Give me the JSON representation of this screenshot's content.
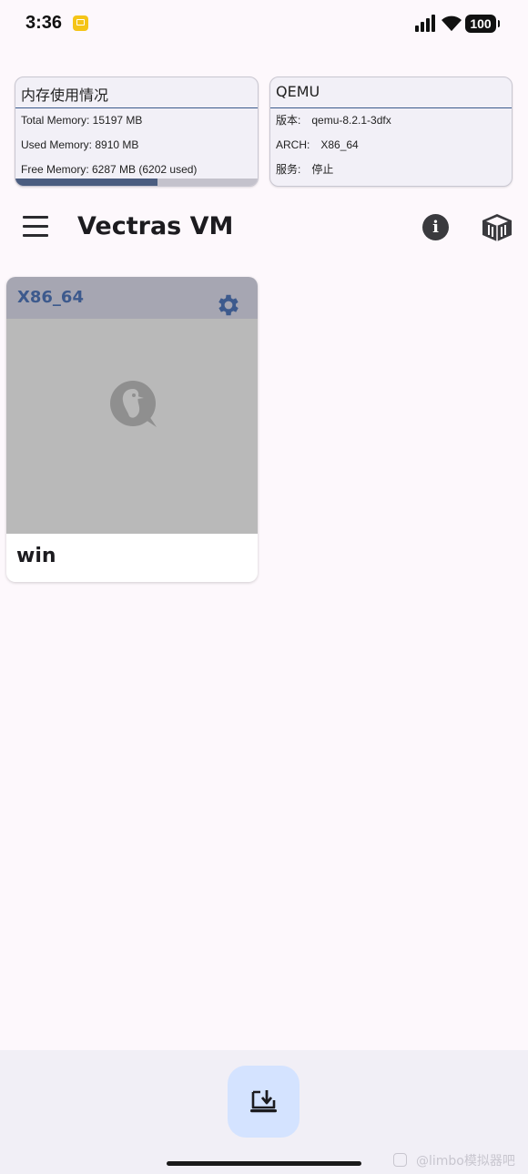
{
  "status_bar": {
    "time": "3:36",
    "battery": "100",
    "notification_icon": "mail-icon"
  },
  "memory_card": {
    "title": "内存使用情况",
    "total": "Total Memory: 15197 MB",
    "used": "Used Memory: 8910 MB",
    "free": "Free Memory: 6287 MB (6202 used)",
    "usage_fraction": 0.586
  },
  "qemu_card": {
    "title": "QEMU",
    "version_label": "版本:",
    "version_value": "qemu-8.2.1-3dfx",
    "arch_label": "ARCH:",
    "arch_value": "X86_64",
    "service_label": "服务:",
    "service_value": "停止"
  },
  "toolbar": {
    "title": "Vectras VM",
    "menu_icon": "menu-icon",
    "info_icon": "info-icon",
    "store_icon": "cube-icon"
  },
  "vms": [
    {
      "arch": "X86_64",
      "name": "win",
      "settings_icon": "gear-icon"
    }
  ],
  "fab": {
    "icon": "import-vm-icon"
  },
  "watermark": "@limbo模拟器吧",
  "colors": {
    "background": "#fdf8fc",
    "accent": "#3d5a8d",
    "fab": "#d4e3ff"
  }
}
